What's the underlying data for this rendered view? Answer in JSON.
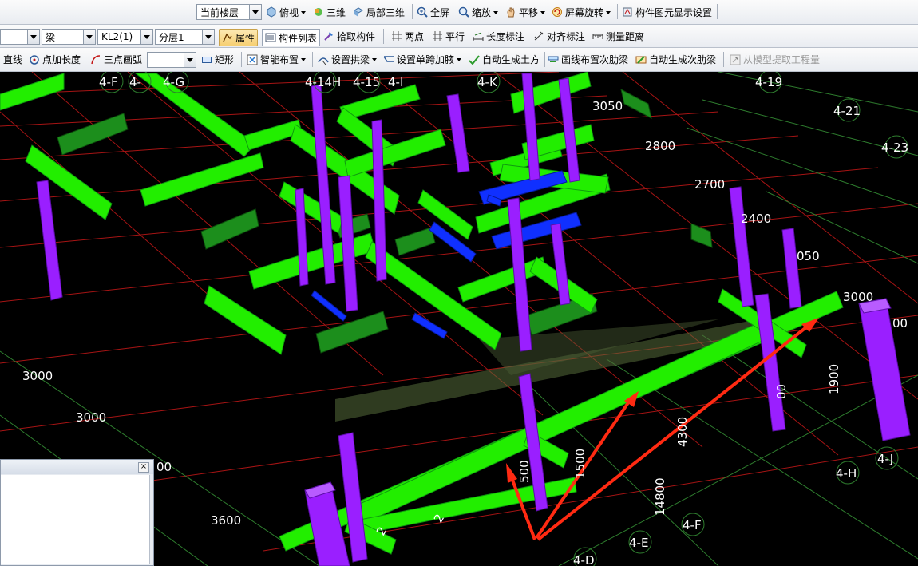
{
  "toolbar1": {
    "floor_label": "当前楼层",
    "view_top": "俯视",
    "view_3d": "三维",
    "view_local3d": "局部三维",
    "fullscreen": "全屏",
    "zoom": "缩放",
    "pan": "平移",
    "rotate": "屏幕旋转",
    "display_settings": "构件图元显示设置"
  },
  "toolbar2": {
    "category_value": "梁",
    "component_value": "KL2(1)",
    "layer_value": "分层1",
    "properties": "属性",
    "component_list": "构件列表",
    "pick_component": "拾取构件",
    "two_points": "两点",
    "parallel": "平行",
    "length_dim": "长度标注",
    "aligned_dim": "对齐标注",
    "measure": "测量距离"
  },
  "toolbar3": {
    "line": "直线",
    "point_length": "点加长度",
    "three_point_arc": "三点画弧",
    "rect": "矩形",
    "smart_layout": "智能布置",
    "set_arch": "设置拱梁",
    "set_haunch": "设置单跨加腋",
    "auto_earthwork": "自动生成土方",
    "draw_secondary_rib": "画线布置次肋梁",
    "auto_secondary_rib": "自动生成次肋梁",
    "extract_quantity": "从模型提取工程量"
  },
  "colors": {
    "background": "#000000",
    "beam": "#22ee00",
    "beam_dark": "#1a8f1a",
    "column": "#9a1fff",
    "blue_member": "#1030ff",
    "grid_red": "#d11a1a",
    "grid_green": "#2e7d2e",
    "arrow": "#ff2a12"
  },
  "viewport": {
    "axis_labels": [
      "4-F",
      "4-",
      "4-G",
      "4-14H",
      "4-15",
      "4-I",
      "4-K",
      "4-19",
      "4-21",
      "4-23",
      "4-J",
      "4-H",
      "4-F",
      "4-E",
      "4-D"
    ],
    "dimensions": [
      "3050",
      "2800",
      "2700",
      "2400",
      "050",
      "3000",
      "00",
      "1900",
      "00",
      "4300",
      "1500",
      "500",
      "14800",
      "3000",
      "3000",
      "00",
      "3600",
      "2",
      "2"
    ]
  }
}
